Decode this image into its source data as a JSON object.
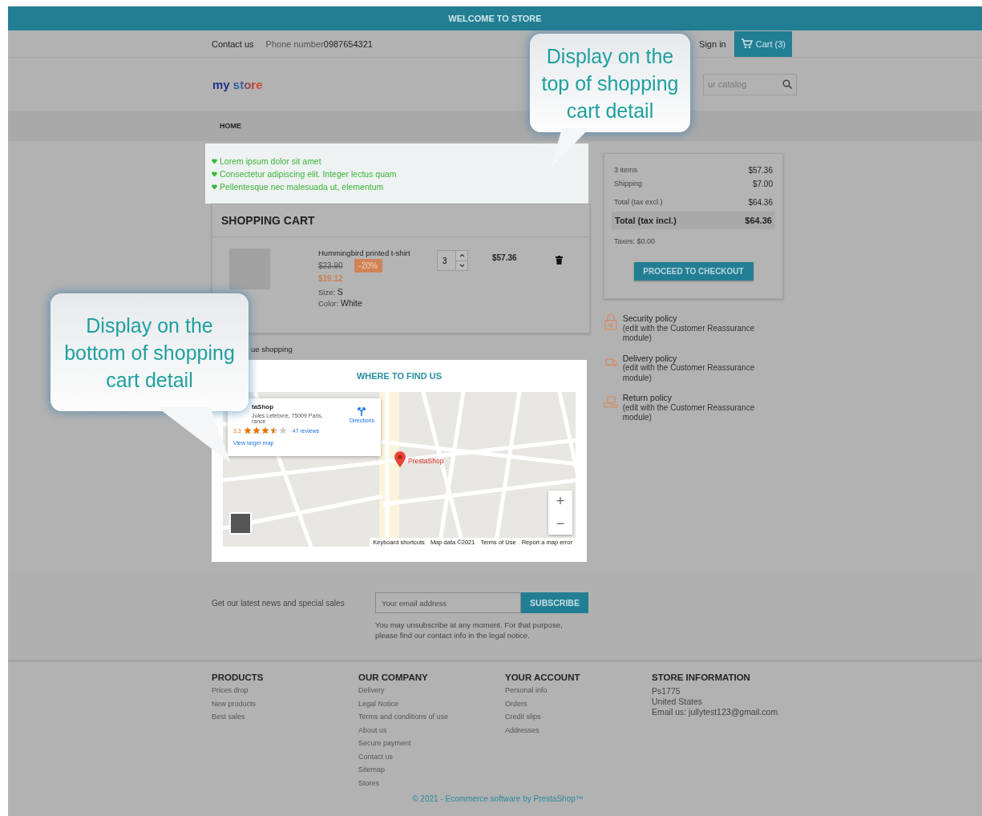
{
  "top_banner": {
    "text": "WELCOME TO STORE"
  },
  "header": {
    "contact": "Contact us",
    "phone_label": "Phone number",
    "phone": "0987654321",
    "sign_in": "Sign in",
    "cart": "Cart (3)",
    "logo": "my store",
    "search": {
      "placeholder": "ur catalog"
    }
  },
  "menu": [
    {
      "label": "HOME"
    }
  ],
  "top_reassurance": [
    "Lorem ipsum dolor sit amet",
    "Consectetur adipiscing elit. Integer lectus quam",
    "Pellentesque nec malesuada ut, elementum"
  ],
  "cart": {
    "title": "SHOPPING CART",
    "items": [
      {
        "name": "Hummingbird printed t-shirt",
        "regular_price": "$23.90",
        "discount": "-20%",
        "price": "$19.12",
        "attributes": [
          {
            "label": "Size:",
            "value": "S"
          },
          {
            "label": "Color:",
            "value": "White"
          }
        ],
        "quantity": "3",
        "total": "$57.36"
      }
    ],
    "continue": "ue shopping"
  },
  "map_section": {
    "title": "WHERE TO FIND US",
    "place": {
      "name": "taShop",
      "address_1": "Jules Lefebvre, 75009 Paris,",
      "address_2": "rance",
      "rating": "3.3",
      "stars": 3.5,
      "reviews": "47 reviews",
      "directions": "Directions",
      "larger_map": "View larger map"
    },
    "marker": "PrestaShop",
    "zoom_controls": [
      "+",
      "−"
    ],
    "attribution": [
      "Keyboard shortcuts",
      "Map data ©2021",
      "Terms of Use",
      "Report a map error"
    ]
  },
  "summary": {
    "lines": [
      {
        "label": "3 items",
        "value": "$57.36"
      },
      {
        "label": "Shipping",
        "value": "$7.00"
      },
      {
        "label": "Total (tax excl.)",
        "value": "$64.36"
      }
    ],
    "total": {
      "label": "Total (tax incl.)",
      "value": "$64.36"
    },
    "taxes": "Taxes: $0.00",
    "checkout": "PROCEED TO CHECKOUT"
  },
  "reassurance": [
    {
      "kind": "lock",
      "title": "Security policy",
      "note": "(edit with the Customer Reassurance module)"
    },
    {
      "kind": "truck",
      "title": "Delivery policy",
      "note": "(edit with the Customer Reassurance module)"
    },
    {
      "kind": "box",
      "title": "Return policy",
      "note": "(edit with the Customer Reassurance module)"
    }
  ],
  "newsletter": {
    "label": "Get our latest news and special sales",
    "placeholder": "Your email address",
    "button": "SUBSCRIBE",
    "note": "You may unsubscribe at any moment. For that purpose, please find our contact info in the legal notice."
  },
  "footer": {
    "columns": [
      {
        "title": "PRODUCTS",
        "links": [
          "Prices drop",
          "New products",
          "Best sales"
        ]
      },
      {
        "title": "OUR COMPANY",
        "links": [
          "Delivery",
          "Legal Notice",
          "Terms and conditions of use",
          "About us",
          "Secure payment",
          "Contact us",
          "Sitemap",
          "Stores"
        ]
      },
      {
        "title": "YOUR ACCOUNT",
        "links": [
          "Personal info",
          "Orders",
          "Credit slips",
          "Addresses"
        ]
      }
    ],
    "store_info": {
      "title": "STORE INFORMATION",
      "lines": [
        "Ps1775",
        "United States",
        "Email us: jullytest123@gmail.com"
      ]
    },
    "copyright": "© 2021 - Ecommerce software by PrestaShop™"
  },
  "callouts": [
    {
      "lines": [
        "Display on the",
        "top of shopping",
        "cart detail"
      ]
    },
    {
      "lines": [
        "Display on the",
        "bottom of shopping",
        "cart detail"
      ]
    }
  ]
}
